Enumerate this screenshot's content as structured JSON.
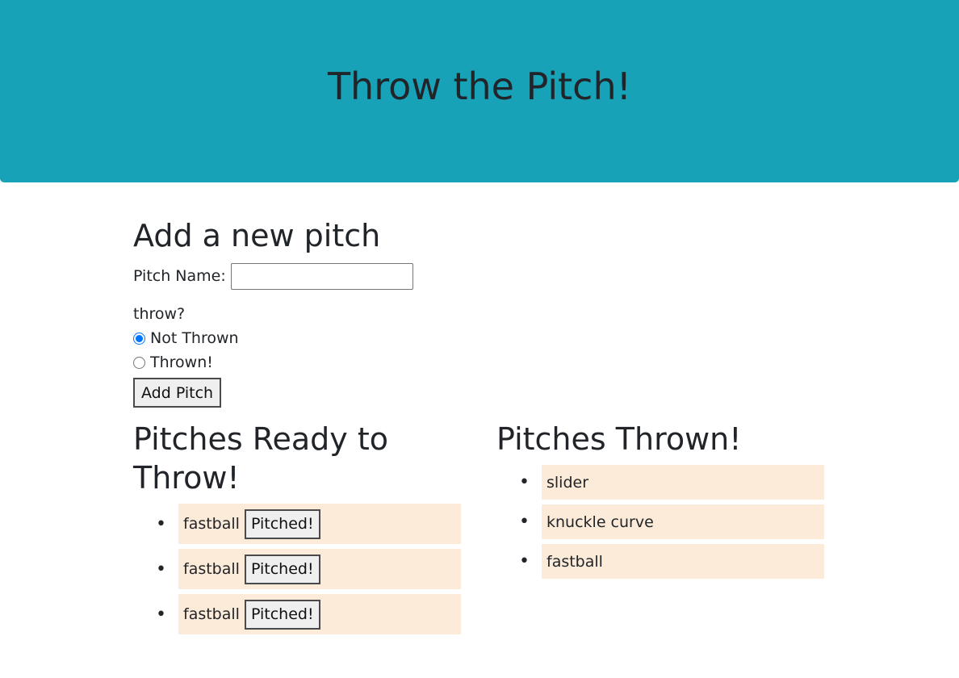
{
  "header": {
    "title": "Throw the Pitch!"
  },
  "form": {
    "title": "Add a new pitch",
    "name_label": "Pitch Name:",
    "name_value": "",
    "throw_label": "throw?",
    "options": [
      {
        "label": "Not Thrown",
        "checked": true
      },
      {
        "label": "Thrown!",
        "checked": false
      }
    ],
    "submit_label": "Add Pitch"
  },
  "ready": {
    "title": "Pitches Ready to Throw!",
    "items": [
      {
        "name": "fastball",
        "button": "Pitched!"
      },
      {
        "name": "fastball",
        "button": "Pitched!"
      },
      {
        "name": "fastball",
        "button": "Pitched!"
      }
    ]
  },
  "thrown": {
    "title": "Pitches Thrown!",
    "items": [
      {
        "name": "slider"
      },
      {
        "name": "knuckle curve"
      },
      {
        "name": "fastball"
      }
    ]
  },
  "colors": {
    "header_bg": "#17a2b8",
    "item_bg": "#fbebd8"
  }
}
